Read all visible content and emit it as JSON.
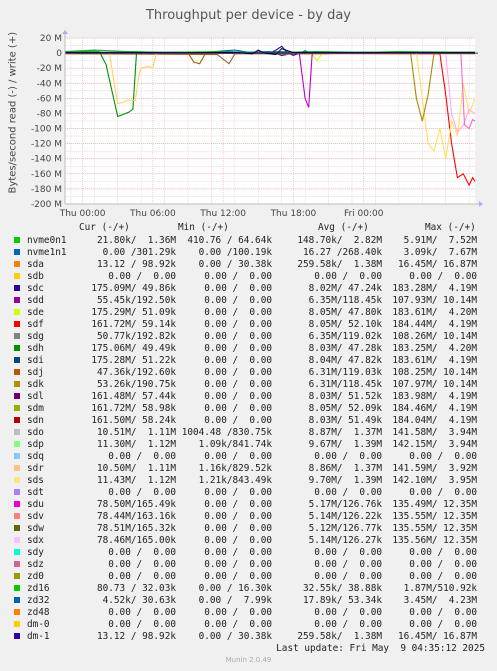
{
  "title": "Throughput per device - by day",
  "ylabel": "Bytes/second read (-) / write (+)",
  "watermark": "RRDTOOL / TOBI OETIKER",
  "munin_version": "Munin 2.0.49",
  "last_update": "Last update: Fri May  9 04:35:12 2025",
  "legend_headers": {
    "cur": "Cur (-/+)",
    "min": "Min (-/+)",
    "avg": "Avg (-/+)",
    "max": "Max (-/+)"
  },
  "chart_data": {
    "type": "line",
    "title": "Throughput per device - by day",
    "ylabel": "Bytes/second read (-) / write (+)",
    "ylim": [
      -200,
      20
    ],
    "yunit": "M",
    "yticks": [
      20,
      0,
      -20,
      -40,
      -60,
      -80,
      -100,
      -120,
      -140,
      -160,
      -180,
      -200
    ],
    "ytick_labels": [
      "20 M",
      "0",
      "-20 M",
      "-40 M",
      "-60 M",
      "-80 M",
      "-100 M",
      "-120 M",
      "-140 M",
      "-160 M",
      "-180 M",
      "-200 M"
    ],
    "xlim_hours": [
      -1.5,
      33.5
    ],
    "xticks": [
      {
        "label": "Thu 00:00",
        "hour": 0
      },
      {
        "label": "Thu 06:00",
        "hour": 6
      },
      {
        "label": "Thu 12:00",
        "hour": 12
      },
      {
        "label": "Thu 18:00",
        "hour": 18
      },
      {
        "label": "Fri 00:00",
        "hour": 24
      }
    ],
    "grid": true,
    "series": [
      {
        "name": "sdc",
        "color": "#330099",
        "values": [
          [
            -1.5,
            1
          ],
          [
            8,
            0
          ],
          [
            9.5,
            -0.5
          ],
          [
            11,
            -1
          ],
          [
            14,
            1
          ],
          [
            16,
            2
          ],
          [
            17,
            -3
          ],
          [
            18.5,
            1
          ],
          [
            20,
            1
          ],
          [
            22,
            0.5
          ],
          [
            24,
            1
          ],
          [
            29,
            1
          ],
          [
            31,
            0.5
          ],
          [
            33.5,
            1
          ]
        ]
      },
      {
        "name": "sde",
        "color": "#ccff00",
        "values": [
          [
            -1.5,
            0
          ],
          [
            5,
            -1
          ],
          [
            7,
            0.5
          ],
          [
            11,
            0.5
          ],
          [
            14,
            1
          ],
          [
            16,
            0
          ],
          [
            20,
            1
          ],
          [
            24,
            0
          ],
          [
            33.5,
            1
          ]
        ]
      },
      {
        "name": "sdg",
        "color": "#3a9937",
        "values": [
          [
            -1.5,
            2
          ],
          [
            1,
            4
          ],
          [
            4,
            2
          ],
          [
            7,
            0.5
          ],
          [
            10,
            1
          ],
          [
            12,
            1
          ],
          [
            14,
            1
          ],
          [
            17,
            2
          ],
          [
            20,
            0
          ],
          [
            24,
            1
          ],
          [
            33.5,
            0.5
          ]
        ]
      },
      {
        "name": "sdh",
        "color": "#0066b3",
        "values": [
          [
            -1.5,
            0.5
          ],
          [
            10,
            0.5
          ],
          [
            13,
            4
          ],
          [
            14.5,
            0
          ],
          [
            18,
            0.5
          ],
          [
            24,
            0
          ],
          [
            33.5,
            0.5
          ]
        ]
      },
      {
        "name": "sdj",
        "color": "#996633",
        "values": [
          [
            -1.5,
            -1
          ],
          [
            11.5,
            -2
          ],
          [
            12.5,
            -14
          ],
          [
            13,
            -1
          ],
          [
            20,
            -1
          ],
          [
            24,
            0
          ],
          [
            33.5,
            -1
          ]
        ]
      },
      {
        "name": "sdk",
        "color": "#996600",
        "values": [
          [
            -1.5,
            0
          ],
          [
            9,
            0
          ],
          [
            9.5,
            -12
          ],
          [
            10,
            -14
          ],
          [
            10.5,
            0
          ],
          [
            33.5,
            0
          ]
        ]
      },
      {
        "name": "sdl",
        "color": "#330099",
        "values": [
          [
            -1.5,
            1
          ],
          [
            16,
            0
          ],
          [
            16.5,
            4
          ],
          [
            17,
            9
          ],
          [
            17.5,
            0
          ],
          [
            18,
            -3
          ],
          [
            19,
            3
          ],
          [
            19.5,
            0
          ],
          [
            33.5,
            1
          ]
        ]
      },
      {
        "name": "sdm",
        "color": "#ccff00",
        "values": [
          [
            -1.5,
            0
          ],
          [
            19.5,
            0
          ],
          [
            20,
            -10
          ],
          [
            20.5,
            0
          ],
          [
            33.5,
            0
          ]
        ]
      },
      {
        "name": "sdn",
        "color": "#ff0000",
        "values": [
          [
            -1.5,
            0
          ],
          [
            30.5,
            -1
          ],
          [
            31,
            -55
          ],
          [
            31.5,
            -120
          ],
          [
            32,
            -165
          ],
          [
            32.5,
            -160
          ],
          [
            33,
            -175
          ],
          [
            33.3,
            -165
          ],
          [
            33.5,
            -170
          ]
        ]
      },
      {
        "name": "sdo",
        "color": "#808080",
        "values": [
          [
            -1.5,
            0
          ],
          [
            17,
            0
          ],
          [
            17.5,
            -2
          ],
          [
            18,
            0
          ],
          [
            33.5,
            0
          ]
        ]
      },
      {
        "name": "sdp",
        "color": "#008f00",
        "values": [
          [
            -1.5,
            0
          ],
          [
            1.5,
            0
          ],
          [
            2,
            -15
          ],
          [
            2.5,
            -50
          ],
          [
            3,
            -84
          ],
          [
            3.5,
            -81
          ],
          [
            4,
            -78
          ],
          [
            4.3,
            -74
          ],
          [
            4.6,
            0
          ],
          [
            33.5,
            0
          ]
        ]
      },
      {
        "name": "sdr",
        "color": "#ffd05d",
        "values": [
          [
            -1.5,
            0
          ],
          [
            2.3,
            0
          ],
          [
            2.7,
            -40
          ],
          [
            3,
            -67
          ],
          [
            3.5,
            -65
          ],
          [
            4,
            -62
          ],
          [
            4.5,
            -63
          ],
          [
            4.8,
            -30
          ],
          [
            5,
            -20
          ],
          [
            5.5,
            -18
          ],
          [
            6,
            -19
          ],
          [
            6.3,
            0
          ],
          [
            33.5,
            0
          ]
        ]
      },
      {
        "name": "sds",
        "color": "#ffe060",
        "values": [
          [
            -1.5,
            0
          ],
          [
            28.5,
            0
          ],
          [
            29,
            -60
          ],
          [
            29.5,
            -120
          ],
          [
            30,
            -130
          ],
          [
            30.5,
            -100
          ],
          [
            31,
            -140
          ],
          [
            31.5,
            -90
          ],
          [
            32,
            -110
          ],
          [
            32.5,
            -40
          ],
          [
            33,
            -80
          ],
          [
            33.5,
            -60
          ]
        ]
      },
      {
        "name": "sdu",
        "color": "#c000c0",
        "values": [
          [
            -1.5,
            0
          ],
          [
            18.5,
            0
          ],
          [
            19,
            -60
          ],
          [
            19.3,
            -72
          ],
          [
            19.6,
            0
          ],
          [
            33.5,
            0
          ]
        ]
      },
      {
        "name": "sdv",
        "color": "#ffaaee",
        "values": [
          [
            -1.5,
            0
          ],
          [
            31,
            0
          ],
          [
            31.5,
            -80
          ],
          [
            32,
            -105
          ],
          [
            32.5,
            -95
          ],
          [
            33,
            -75
          ],
          [
            33.5,
            -80
          ]
        ]
      },
      {
        "name": "sdw",
        "color": "#ff66cc",
        "values": [
          [
            -1.5,
            0
          ],
          [
            32.3,
            0
          ],
          [
            32.6,
            -95
          ],
          [
            33,
            -100
          ],
          [
            33.3,
            -88
          ],
          [
            33.5,
            -90
          ]
        ]
      },
      {
        "name": "sdx",
        "color": "#aa8800",
        "values": [
          [
            -1.5,
            0
          ],
          [
            28,
            0
          ],
          [
            28.5,
            -60
          ],
          [
            29,
            -90
          ],
          [
            29.5,
            -55
          ],
          [
            30,
            -0.5
          ],
          [
            33.5,
            0
          ]
        ]
      },
      {
        "name": "zd16",
        "color": "#00cc00",
        "values": [
          [
            -1.5,
            1
          ],
          [
            1,
            3
          ],
          [
            2,
            0
          ],
          [
            4,
            2
          ],
          [
            7,
            1
          ],
          [
            12,
            2
          ],
          [
            14,
            1
          ],
          [
            17,
            1
          ],
          [
            20,
            2
          ],
          [
            24,
            1
          ],
          [
            27,
            2
          ],
          [
            33.5,
            1
          ]
        ]
      },
      {
        "name": "zd32",
        "color": "#0066b3",
        "values": [
          [
            -1.5,
            1
          ],
          [
            8,
            1
          ],
          [
            9,
            0.5
          ],
          [
            12,
            1
          ],
          [
            18,
            1
          ],
          [
            24,
            1
          ],
          [
            33.5,
            1
          ]
        ]
      },
      {
        "name": "dm-1",
        "color": "#000066",
        "values": [
          [
            -1.5,
            0.5
          ],
          [
            10,
            0.5
          ],
          [
            13,
            1
          ],
          [
            14.5,
            -1
          ],
          [
            15,
            4
          ],
          [
            15.5,
            0
          ],
          [
            16.5,
            -2
          ],
          [
            17,
            6
          ],
          [
            18,
            0.5
          ],
          [
            24,
            0.5
          ],
          [
            33.5,
            0.5
          ]
        ]
      }
    ]
  },
  "legend_rows": [
    {
      "name": "nvme0n1",
      "color": "#00cc00",
      "cur": "21.80k/  1.36M",
      "min": "410.76 / 64.64k",
      "avg": "148.70k/  2.82M",
      "max": "5.91M/  7.52M"
    },
    {
      "name": "nvme1n1",
      "color": "#0066b3",
      "cur": " 0.00 /301.29k",
      "min": " 0.00 /100.19k",
      "avg": "16.27 /268.40k",
      "max": "3.09k/  7.67M"
    },
    {
      "name": "sda",
      "color": "#ff8000",
      "cur": "13.12 / 98.92k",
      "min": " 0.00 / 30.38k",
      "avg": "259.58k/  1.38M",
      "max": "16.45M/ 16.87M"
    },
    {
      "name": "sdb",
      "color": "#ffcc00",
      "cur": " 0.00 /  0.00",
      "min": " 0.00 /  0.00",
      "avg": " 0.00 /  0.00",
      "max": " 0.00 /  0.00"
    },
    {
      "name": "sdc",
      "color": "#330099",
      "cur": "175.09M/ 49.86k",
      "min": " 0.00 /  0.00",
      "avg": "8.02M/ 47.24k",
      "max": "183.28M/  4.19M"
    },
    {
      "name": "sdd",
      "color": "#990099",
      "cur": "55.45k/192.50k",
      "min": " 0.00 /  0.00",
      "avg": "6.35M/118.45k",
      "max": "107.93M/ 10.14M"
    },
    {
      "name": "sde",
      "color": "#ccff00",
      "cur": "175.29M/ 51.09k",
      "min": " 0.00 /  0.00",
      "avg": "8.05M/ 47.80k",
      "max": "183.61M/  4.20M"
    },
    {
      "name": "sdf",
      "color": "#ff0000",
      "cur": "161.72M/ 59.14k",
      "min": " 0.00 /  0.00",
      "avg": "8.05M/ 52.10k",
      "max": "184.44M/  4.19M"
    },
    {
      "name": "sdg",
      "color": "#808080",
      "cur": "50.77k/192.82k",
      "min": " 0.00 /  0.00",
      "avg": "6.35M/119.02k",
      "max": "108.26M/ 10.14M"
    },
    {
      "name": "sdh",
      "color": "#008f00",
      "cur": "175.06M/ 49.49k",
      "min": " 0.00 /  0.00",
      "avg": "8.03M/ 47.28k",
      "max": "183.25M/  4.20M"
    },
    {
      "name": "sdi",
      "color": "#00487d",
      "cur": "175.28M/ 51.22k",
      "min": " 0.00 /  0.00",
      "avg": "8.04M/ 47.82k",
      "max": "183.61M/  4.19M"
    },
    {
      "name": "sdj",
      "color": "#b35a00",
      "cur": "47.36k/192.60k",
      "min": " 0.00 /  0.00",
      "avg": "6.31M/119.03k",
      "max": "108.25M/ 10.14M"
    },
    {
      "name": "sdk",
      "color": "#b38f00",
      "cur": "53.26k/190.75k",
      "min": " 0.00 /  0.00",
      "avg": "6.31M/118.45k",
      "max": "107.97M/ 10.14M"
    },
    {
      "name": "sdl",
      "color": "#6b006b",
      "cur": "161.48M/ 57.44k",
      "min": " 0.00 /  0.00",
      "avg": "8.03M/ 51.52k",
      "max": "183.98M/  4.19M"
    },
    {
      "name": "sdm",
      "color": "#8fb300",
      "cur": "161.72M/ 58.98k",
      "min": " 0.00 /  0.00",
      "avg": "8.05M/ 52.09k",
      "max": "184.46M/  4.19M"
    },
    {
      "name": "sdn",
      "color": "#b30000",
      "cur": "161.50M/ 58.24k",
      "min": " 0.00 /  0.00",
      "avg": "8.03M/ 51.49k",
      "max": "184.04M/  4.19M"
    },
    {
      "name": "sdo",
      "color": "#bebebe",
      "cur": "10.51M/  1.11M",
      "min": "1004.48 /830.75k",
      "avg": "8.87M/  1.37M",
      "max": "141.58M/  3.94M"
    },
    {
      "name": "sdp",
      "color": "#80ff80",
      "cur": "11.30M/  1.12M",
      "min": "1.09k/841.74k",
      "avg": "9.67M/  1.39M",
      "max": "142.15M/  3.94M"
    },
    {
      "name": "sdq",
      "color": "#80c9ff",
      "cur": " 0.00 /  0.00",
      "min": " 0.00 /  0.00",
      "avg": " 0.00 /  0.00",
      "max": " 0.00 /  0.00"
    },
    {
      "name": "sdr",
      "color": "#ffc080",
      "cur": "10.50M/  1.11M",
      "min": "1.16k/829.52k",
      "avg": "8.86M/  1.37M",
      "max": "141.59M/  3.92M"
    },
    {
      "name": "sds",
      "color": "#ffe680",
      "cur": "11.43M/  1.12M",
      "min": "1.21k/843.49k",
      "avg": "9.70M/  1.39M",
      "max": "142.10M/  3.95M"
    },
    {
      "name": "sdt",
      "color": "#aa80ff",
      "cur": " 0.00 /  0.00",
      "min": " 0.00 /  0.00",
      "avg": " 0.00 /  0.00",
      "max": " 0.00 /  0.00"
    },
    {
      "name": "sdu",
      "color": "#ee00cc",
      "cur": "78.50M/165.49k",
      "min": " 0.00 /  0.00",
      "avg": "5.17M/126.76k",
      "max": "135.49M/ 12.35M"
    },
    {
      "name": "sdv",
      "color": "#ff8080",
      "cur": "78.44M/163.16k",
      "min": " 0.00 /  0.00",
      "avg": "5.14M/126.22k",
      "max": "135.55M/ 12.35M"
    },
    {
      "name": "sdw",
      "color": "#666600",
      "cur": "78.51M/165.32k",
      "min": " 0.00 /  0.00",
      "avg": "5.12M/126.77k",
      "max": "135.55M/ 12.35M"
    },
    {
      "name": "sdx",
      "color": "#ffbfff",
      "cur": "78.46M/165.00k",
      "min": " 0.00 /  0.00",
      "avg": "5.14M/126.27k",
      "max": "135.56M/ 12.35M"
    },
    {
      "name": "sdy",
      "color": "#00ffcc",
      "cur": " 0.00 /  0.00",
      "min": " 0.00 /  0.00",
      "avg": " 0.00 /  0.00",
      "max": " 0.00 /  0.00"
    },
    {
      "name": "sdz",
      "color": "#cc6699",
      "cur": " 0.00 /  0.00",
      "min": " 0.00 /  0.00",
      "avg": " 0.00 /  0.00",
      "max": " 0.00 /  0.00"
    },
    {
      "name": "zd0",
      "color": "#999900",
      "cur": " 0.00 /  0.00",
      "min": " 0.00 /  0.00",
      "avg": " 0.00 /  0.00",
      "max": " 0.00 /  0.00"
    },
    {
      "name": "zd16",
      "color": "#00cc00",
      "cur": "80.73 / 32.03k",
      "min": " 0.00 / 16.30k",
      "avg": "32.55k/ 38.88k",
      "max": "1.87M/510.92k"
    },
    {
      "name": "zd32",
      "color": "#0066b3",
      "cur": "4.52k/ 30.63k",
      "min": " 0.00 /  7.99k",
      "avg": "17.89k/ 53.34k",
      "max": "3.45M/  4.23M"
    },
    {
      "name": "zd48",
      "color": "#ff8000",
      "cur": " 0.00 /  0.00",
      "min": " 0.00 /  0.00",
      "avg": " 0.00 /  0.00",
      "max": " 0.00 /  0.00"
    },
    {
      "name": "dm-0",
      "color": "#ffcc00",
      "cur": " 0.00 /  0.00",
      "min": " 0.00 /  0.00",
      "avg": " 0.00 /  0.00",
      "max": " 0.00 /  0.00"
    },
    {
      "name": "dm-1",
      "color": "#330099",
      "cur": "13.12 / 98.92k",
      "min": " 0.00 / 30.38k",
      "avg": "259.58k/  1.38M",
      "max": "16.45M/ 16.87M"
    }
  ]
}
